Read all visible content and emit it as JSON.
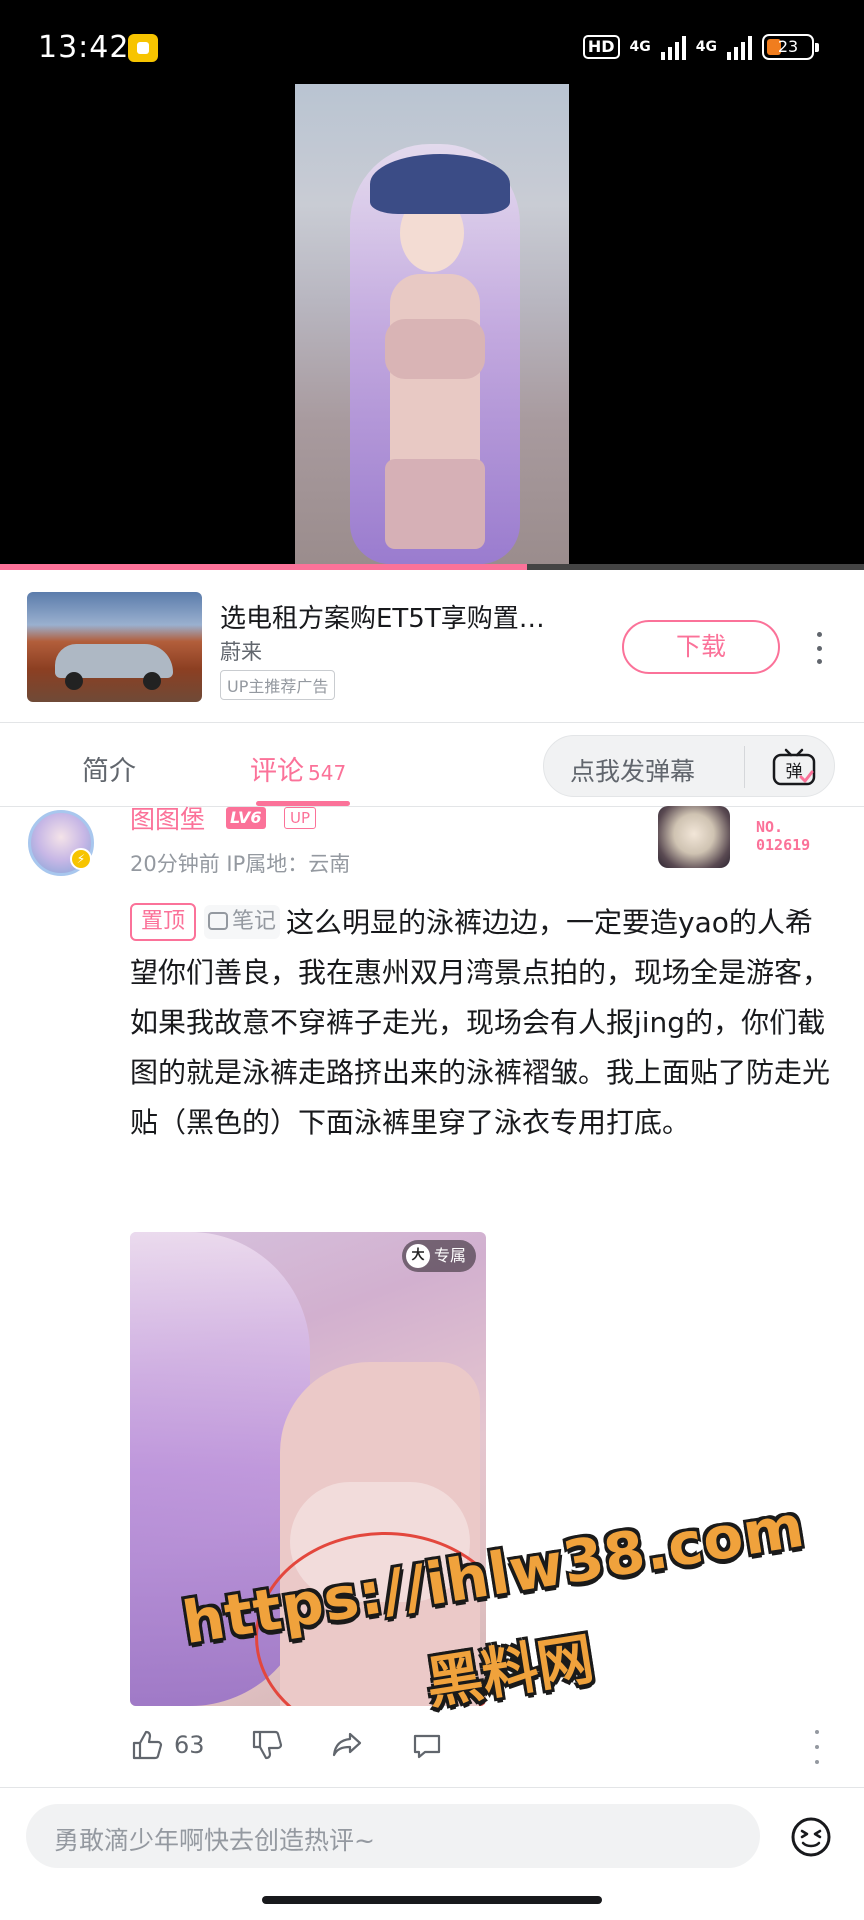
{
  "status_bar": {
    "time": "13:42",
    "hd_label": "HD",
    "network_1": "4G",
    "network_2": "4G",
    "battery": "23"
  },
  "video": {
    "progress_percent": 61
  },
  "ad": {
    "title": "选电租方案购ET5T享购置…",
    "brand": "蔚来",
    "tag": "UP主推荐广告",
    "download_label": "下载"
  },
  "tabs": {
    "intro_label": "简介",
    "comments_label": "评论",
    "comments_count": "547",
    "danmaku_placeholder": "点我发弹幕",
    "danmaku_icon_label": "弹"
  },
  "comment": {
    "username": "图图堡",
    "level": "LV6",
    "up_badge": "UP",
    "meta": "20分钟前 IP属地：云南",
    "fan_number_line1": "NO.",
    "fan_number_line2": "012619",
    "pin_label": "置顶",
    "note_label": "笔记",
    "text": "这么明显的泳裤边边，一定要造yao的人希望你们善良，我在惠州双月湾景点拍的，现场全是游客，如果我故意不穿裤子走光，现场会有人报jing的，你们截图的就是泳裤走路挤出来的泳裤褶皱。我上面贴了防走光贴（黑色的）下面泳裤里穿了泳衣专用打底。",
    "image_badge_icon": "大",
    "image_badge_text": "专属",
    "like_count": "63"
  },
  "overlay": {
    "url": "https://ihlw38.com",
    "subtitle": "黑料网"
  },
  "reply": {
    "placeholder": "勇敢滴少年啊快去创造热评~"
  },
  "colors": {
    "accent": "#fb7299",
    "text_primary": "#18191c",
    "text_secondary": "#61666d",
    "text_muted": "#9499a0"
  },
  "icons": [
    "like-icon",
    "dislike-icon",
    "share-icon",
    "reply-icon",
    "more-icon",
    "emoji-icon",
    "danmaku-icon"
  ]
}
